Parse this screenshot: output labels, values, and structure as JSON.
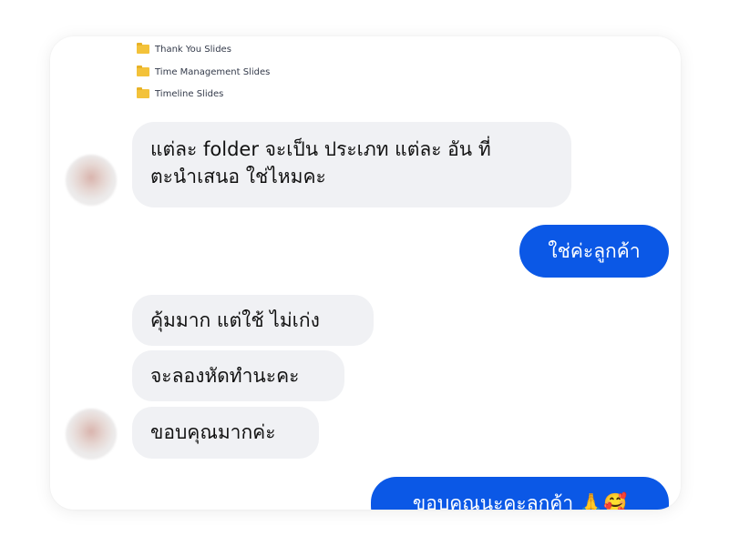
{
  "folders": [
    {
      "name": "Thank You Slides"
    },
    {
      "name": "Time Management Slides"
    },
    {
      "name": "Timeline Slides"
    }
  ],
  "messages": [
    {
      "side": "incoming",
      "lines": [
        "แต่ละ folder จะเป็น ประเภท แต่ละ อัน ที่",
        "ตะนำเสนอ ใช่ไหมคะ"
      ]
    },
    {
      "side": "outgoing",
      "text": "ใช่ค่ะลูกค้า"
    },
    {
      "side": "incoming",
      "text": "คุ้มมาก แต่ใช้ ไม่เก่ง"
    },
    {
      "side": "incoming",
      "text": "จะลองหัดทำนะคะ"
    },
    {
      "side": "incoming",
      "text": "ขอบคุณมากค่ะ"
    },
    {
      "side": "outgoing",
      "text": "ขอบคุณนะคะลูกค้า 🙏🥰"
    }
  ],
  "colors": {
    "incoming_bubble": "#f0f1f4",
    "outgoing_bubble": "#0b58e6",
    "folder": "#f3c23a"
  },
  "icons": {
    "folder": "folder-icon",
    "avatar": "contact-avatar"
  }
}
